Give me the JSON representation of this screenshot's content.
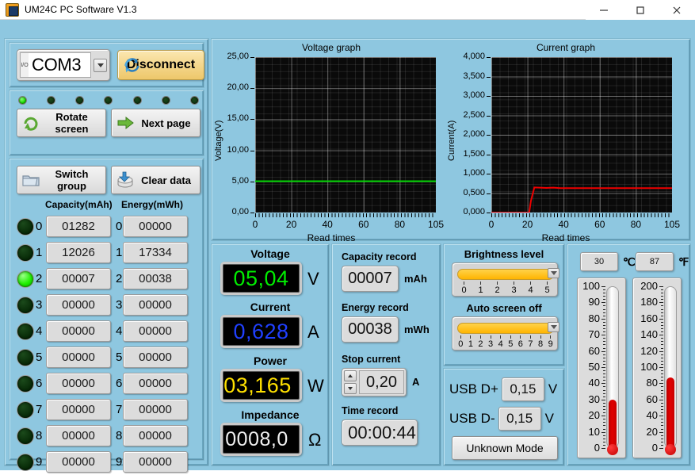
{
  "window": {
    "title": "UM24C PC Software V1.3",
    "icon": "app-icon",
    "minimize": "–",
    "maximize": "□",
    "close": "×"
  },
  "connection": {
    "io_label": "I/O",
    "port_value": "COM3",
    "dropdown_icon": "chevron-down-icon",
    "disconnect_label": "Disconnect",
    "refresh_icon": "refresh-icon",
    "leds": [
      true,
      false,
      false,
      false,
      false,
      false,
      false
    ]
  },
  "nav": {
    "rotate_label": "Rotate screen",
    "rotate_icon": "rotate-arrow-icon",
    "next_label": "Next page",
    "next_icon": "right-arrow-icon",
    "switch_label": "Switch group",
    "switch_icon": "folder-icon",
    "clear_label": "Clear data",
    "clear_icon": "disk-delete-icon"
  },
  "groups": {
    "capacity_header": "Capacity(mAh)",
    "energy_header": "Energy(mWh)",
    "rows": [
      {
        "idx": "0",
        "capacity": "01282",
        "energy": "00000",
        "active": false
      },
      {
        "idx": "1",
        "capacity": "12026",
        "energy": "17334",
        "active": false
      },
      {
        "idx": "2",
        "capacity": "00007",
        "energy": "00038",
        "active": true
      },
      {
        "idx": "3",
        "capacity": "00000",
        "energy": "00000",
        "active": false
      },
      {
        "idx": "4",
        "capacity": "00000",
        "energy": "00000",
        "active": false
      },
      {
        "idx": "5",
        "capacity": "00000",
        "energy": "00000",
        "active": false
      },
      {
        "idx": "6",
        "capacity": "00000",
        "energy": "00000",
        "active": false
      },
      {
        "idx": "7",
        "capacity": "00000",
        "energy": "00000",
        "active": false
      },
      {
        "idx": "8",
        "capacity": "00000",
        "energy": "00000",
        "active": false
      },
      {
        "idx": "9",
        "capacity": "00000",
        "energy": "00000",
        "active": false
      }
    ]
  },
  "chart_data": [
    {
      "type": "line",
      "title": "Voltage graph",
      "xlabel": "Read times",
      "ylabel": "Voltage(V)",
      "xlim": [
        0,
        105
      ],
      "ylim": [
        0,
        25
      ],
      "xticks": [
        "0",
        "20",
        "40",
        "60",
        "80",
        "105"
      ],
      "yticks": [
        "0,00",
        "5,00",
        "10,00",
        "15,00",
        "20,00",
        "25,00"
      ],
      "grid": true,
      "series": [
        {
          "name": "Voltage",
          "color": "#00d400",
          "x": [
            0,
            10,
            20,
            22,
            24,
            30,
            40,
            60,
            80,
            105
          ],
          "values": [
            5.04,
            5.04,
            5.04,
            5.04,
            5.04,
            5.04,
            5.04,
            5.04,
            5.04,
            5.04
          ]
        }
      ]
    },
    {
      "type": "line",
      "title": "Current graph",
      "xlabel": "Read times",
      "ylabel": "Current(A)",
      "xlim": [
        0,
        105
      ],
      "ylim": [
        0,
        4
      ],
      "xticks": [
        "0",
        "20",
        "40",
        "60",
        "80",
        "105"
      ],
      "yticks": [
        "0,000",
        "0,500",
        "1,000",
        "1,500",
        "2,000",
        "2,500",
        "3,000",
        "3,500",
        "4,000"
      ],
      "grid": true,
      "series": [
        {
          "name": "Current",
          "color": "#ee0000",
          "x": [
            0,
            10,
            20,
            22,
            23,
            25,
            28,
            32,
            36,
            40,
            60,
            80,
            105
          ],
          "values": [
            0.0,
            0.0,
            0.0,
            0.0,
            0.3,
            0.645,
            0.64,
            0.632,
            0.64,
            0.628,
            0.628,
            0.628,
            0.628
          ]
        }
      ]
    }
  ],
  "measurements": {
    "voltage_label": "Voltage",
    "voltage_value": "05,04",
    "voltage_unit": "V",
    "voltage_color": "#00ee00",
    "current_label": "Current",
    "current_value": "0,628",
    "current_unit": "A",
    "current_color": "#2040ff",
    "power_label": "Power",
    "power_value": "03,165",
    "power_unit": "W",
    "power_color": "#ffe000",
    "impedance_label": "Impedance",
    "impedance_value": "0008,0",
    "impedance_unit": "Ω",
    "impedance_color": "#f0f0f0"
  },
  "records": {
    "capacity_label": "Capacity record",
    "capacity_value": "00007",
    "capacity_unit": "mAh",
    "energy_label": "Energy record",
    "energy_value": "00038",
    "energy_unit": "mWh",
    "stop_current_label": "Stop current",
    "stop_current_value": "0,20",
    "stop_current_unit": "A",
    "spinner_up_icon": "spinner-up-icon",
    "spinner_down_icon": "spinner-down-icon",
    "time_label": "Time record",
    "time_value": "00:00:44"
  },
  "controls": {
    "brightness_label": "Brightness level",
    "brightness_value": 5,
    "brightness_ticks": [
      "0",
      "1",
      "2",
      "3",
      "4",
      "5"
    ],
    "autooff_label": "Auto screen off",
    "autooff_value": 9,
    "autooff_ticks": [
      "0",
      "1",
      "2",
      "3",
      "4",
      "5",
      "6",
      "7",
      "8",
      "9"
    ],
    "slider_color": "#ffb400"
  },
  "usb": {
    "dplus_label": "USB D+",
    "dplus_value": "0,15",
    "dplus_unit": "V",
    "dminus_label": "USB D-",
    "dminus_value": "0,15",
    "dminus_unit": "V",
    "mode_label": "Unknown Mode"
  },
  "temperature": {
    "celsius_value": "30",
    "celsius_unit": "℃",
    "fahrenheit_value": "87",
    "fahrenheit_unit": "℉",
    "celsius_scale": [
      "100",
      "90",
      "80",
      "70",
      "60",
      "50",
      "40",
      "30",
      "20",
      "10",
      "0"
    ],
    "fahrenheit_scale": [
      "200",
      "180",
      "160",
      "140",
      "120",
      "100",
      "80",
      "60",
      "40",
      "20",
      "0"
    ],
    "celsius_max": 100,
    "fahrenheit_max": 200,
    "mercury_color": "#e00000"
  }
}
